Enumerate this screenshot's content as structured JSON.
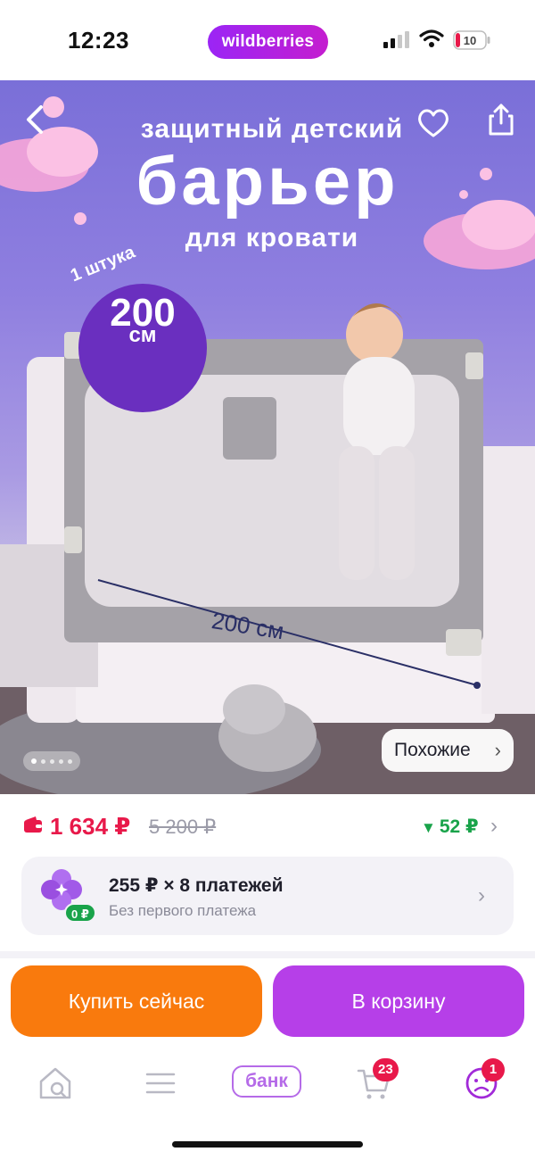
{
  "status_bar": {
    "time": "12:23",
    "brand": "wildberries",
    "battery_level": "10",
    "icons": [
      "signal-icon",
      "wifi-icon",
      "battery-icon"
    ]
  },
  "hero": {
    "title_line1": "защитный детский",
    "title_line2": "барьер",
    "title_line3": "для кровати",
    "quantity_label": "1 штука",
    "size_value": "200",
    "size_unit": "см",
    "dimension_label": "200 см",
    "similar_button": "Похожие",
    "carousel_total": 5,
    "carousel_active": 1,
    "icons": [
      "back-icon",
      "heart-icon",
      "share-icon"
    ]
  },
  "price": {
    "current": "1 634 ₽",
    "old": "5 200 ₽",
    "drop": "52 ₽"
  },
  "installment": {
    "title": "255 ₽ × 8 платежей",
    "subtitle": "Без первого платежа",
    "badge": "0 ₽"
  },
  "actions": {
    "buy_now": "Купить сейчас",
    "add_to_cart": "В корзину"
  },
  "tabbar": {
    "bank_label": "банк",
    "cart_count": "23",
    "profile_count": "1"
  },
  "colors": {
    "accent_purple": "#b63fe8",
    "accent_orange": "#f97a0d",
    "price_red": "#e8194a",
    "drop_green": "#19a34a"
  }
}
